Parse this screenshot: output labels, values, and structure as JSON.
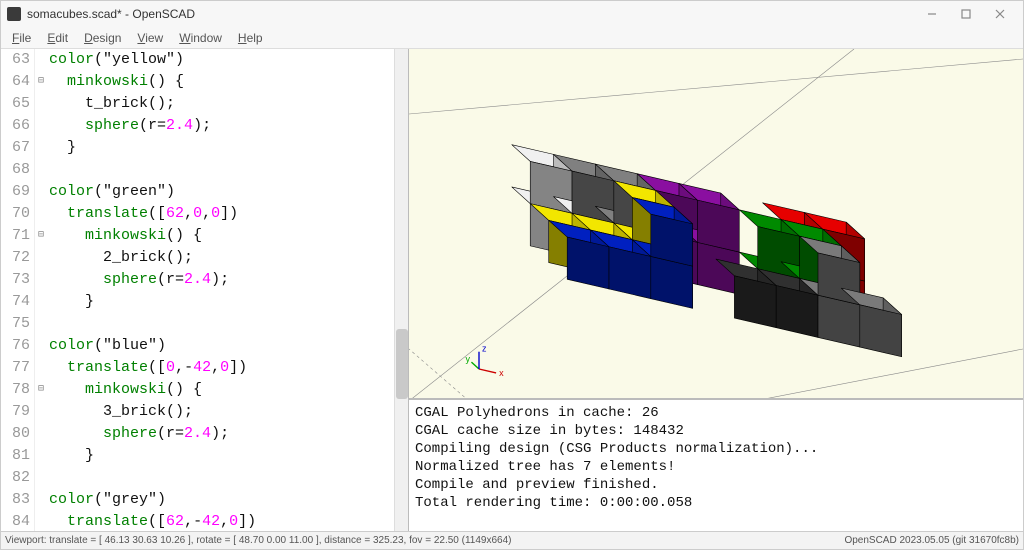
{
  "window": {
    "title": "somacubes.scad* - OpenSCAD"
  },
  "menu": {
    "file": "File",
    "edit": "Edit",
    "design": "Design",
    "view": "View",
    "window": "Window",
    "help": "Help"
  },
  "code": {
    "lines": [
      {
        "n": 63,
        "fold": "",
        "indent": 0,
        "tokens": [
          [
            "kw",
            "color"
          ],
          [
            "p",
            "("
          ],
          [
            "p",
            "\"yellow\""
          ],
          [
            "p",
            ")"
          ]
        ]
      },
      {
        "n": 64,
        "fold": "⊟",
        "indent": 1,
        "tokens": [
          [
            "kw",
            "minkowski"
          ],
          [
            "p",
            "() {"
          ]
        ]
      },
      {
        "n": 65,
        "fold": "",
        "indent": 2,
        "tokens": [
          [
            "p",
            "t_brick();"
          ]
        ]
      },
      {
        "n": 66,
        "fold": "",
        "indent": 2,
        "tokens": [
          [
            "kw",
            "sphere"
          ],
          [
            "p",
            "(r="
          ],
          [
            "num",
            "2.4"
          ],
          [
            "p",
            ");"
          ]
        ]
      },
      {
        "n": 67,
        "fold": "",
        "indent": 1,
        "tokens": [
          [
            "p",
            "}"
          ]
        ]
      },
      {
        "n": 68,
        "fold": "",
        "indent": 0,
        "tokens": []
      },
      {
        "n": 69,
        "fold": "",
        "indent": 0,
        "tokens": [
          [
            "kw",
            "color"
          ],
          [
            "p",
            "("
          ],
          [
            "p",
            "\"green\""
          ],
          [
            "p",
            ")"
          ]
        ]
      },
      {
        "n": 70,
        "fold": "",
        "indent": 1,
        "tokens": [
          [
            "kw",
            "translate"
          ],
          [
            "p",
            "(["
          ],
          [
            "num",
            "62"
          ],
          [
            "p",
            ","
          ],
          [
            "num",
            "0"
          ],
          [
            "p",
            ","
          ],
          [
            "num",
            "0"
          ],
          [
            "p",
            "])"
          ]
        ]
      },
      {
        "n": 71,
        "fold": "⊟",
        "indent": 2,
        "tokens": [
          [
            "kw",
            "minkowski"
          ],
          [
            "p",
            "() {"
          ]
        ]
      },
      {
        "n": 72,
        "fold": "",
        "indent": 3,
        "tokens": [
          [
            "p",
            "2_brick();"
          ]
        ]
      },
      {
        "n": 73,
        "fold": "",
        "indent": 3,
        "tokens": [
          [
            "kw",
            "sphere"
          ],
          [
            "p",
            "(r="
          ],
          [
            "num",
            "2.4"
          ],
          [
            "p",
            ");"
          ]
        ]
      },
      {
        "n": 74,
        "fold": "",
        "indent": 2,
        "tokens": [
          [
            "p",
            "}"
          ]
        ]
      },
      {
        "n": 75,
        "fold": "",
        "indent": 0,
        "tokens": []
      },
      {
        "n": 76,
        "fold": "",
        "indent": 0,
        "tokens": [
          [
            "kw",
            "color"
          ],
          [
            "p",
            "("
          ],
          [
            "p",
            "\"blue\""
          ],
          [
            "p",
            ")"
          ]
        ]
      },
      {
        "n": 77,
        "fold": "",
        "indent": 1,
        "tokens": [
          [
            "kw",
            "translate"
          ],
          [
            "p",
            "(["
          ],
          [
            "num",
            "0"
          ],
          [
            "p",
            ",-"
          ],
          [
            "num",
            "42"
          ],
          [
            "p",
            ","
          ],
          [
            "num",
            "0"
          ],
          [
            "p",
            "])"
          ]
        ]
      },
      {
        "n": 78,
        "fold": "⊟",
        "indent": 2,
        "tokens": [
          [
            "kw",
            "minkowski"
          ],
          [
            "p",
            "() {"
          ]
        ]
      },
      {
        "n": 79,
        "fold": "",
        "indent": 3,
        "tokens": [
          [
            "p",
            "3_brick();"
          ]
        ]
      },
      {
        "n": 80,
        "fold": "",
        "indent": 3,
        "tokens": [
          [
            "kw",
            "sphere"
          ],
          [
            "p",
            "(r="
          ],
          [
            "num",
            "2.4"
          ],
          [
            "p",
            ");"
          ]
        ]
      },
      {
        "n": 81,
        "fold": "",
        "indent": 2,
        "tokens": [
          [
            "p",
            "}"
          ]
        ]
      },
      {
        "n": 82,
        "fold": "",
        "indent": 0,
        "tokens": []
      },
      {
        "n": 83,
        "fold": "",
        "indent": 0,
        "tokens": [
          [
            "kw",
            "color"
          ],
          [
            "p",
            "("
          ],
          [
            "p",
            "\"grey\""
          ],
          [
            "p",
            ")"
          ]
        ]
      },
      {
        "n": 84,
        "fold": "",
        "indent": 1,
        "tokens": [
          [
            "kw",
            "translate"
          ],
          [
            "p",
            "(["
          ],
          [
            "num",
            "62"
          ],
          [
            "p",
            ",-"
          ],
          [
            "num",
            "42"
          ],
          [
            "p",
            ","
          ],
          [
            "num",
            "0"
          ],
          [
            "p",
            "])"
          ]
        ]
      }
    ]
  },
  "viewport_axes": {
    "x": "x",
    "y": "y",
    "z": "z"
  },
  "pieces": [
    {
      "color": "#f0f0f0",
      "dark": "#c8c8c8",
      "cells": [
        [
          -1,
          2,
          0
        ],
        [
          -1,
          2,
          1
        ],
        [
          0,
          2,
          0
        ]
      ]
    },
    {
      "color": "#808080",
      "dark": "#5a5a5a",
      "cells": [
        [
          0,
          2,
          1
        ],
        [
          1,
          2,
          0
        ],
        [
          1,
          2,
          1
        ]
      ]
    },
    {
      "color": "#8a0fa0",
      "dark": "#600b70",
      "cells": [
        [
          2,
          2,
          0
        ],
        [
          2,
          2,
          1
        ],
        [
          3,
          2,
          0
        ],
        [
          3,
          2,
          1
        ]
      ]
    },
    {
      "color": "#e60000",
      "dark": "#a80000",
      "cells": [
        [
          5,
          2,
          1
        ],
        [
          6,
          2,
          0
        ],
        [
          6,
          2,
          1
        ]
      ]
    },
    {
      "color": "#f2e600",
      "dark": "#b8b000",
      "cells": [
        [
          -1,
          1,
          0
        ],
        [
          0,
          1,
          0
        ],
        [
          1,
          1,
          0
        ],
        [
          1,
          1,
          1
        ]
      ]
    },
    {
      "color": "#008a00",
      "dark": "#006000",
      "cells": [
        [
          4,
          1,
          0
        ],
        [
          4,
          1,
          1
        ],
        [
          5,
          1,
          0
        ],
        [
          5,
          1,
          1
        ]
      ]
    },
    {
      "color": "#0020c0",
      "dark": "#001680",
      "cells": [
        [
          -1,
          0,
          0
        ],
        [
          0,
          0,
          0
        ],
        [
          1,
          0,
          0
        ],
        [
          1,
          0,
          1
        ]
      ]
    },
    {
      "color": "#303030",
      "dark": "#181818",
      "cells": [
        [
          3,
          0,
          0
        ],
        [
          4,
          0,
          0
        ]
      ]
    },
    {
      "color": "#7a7a7a",
      "dark": "#585858",
      "cells": [
        [
          5,
          0,
          0
        ],
        [
          6,
          0,
          0
        ],
        [
          5,
          0,
          1
        ]
      ]
    }
  ],
  "console": {
    "lines": [
      "CGAL Polyhedrons in cache: 26",
      "CGAL cache size in bytes: 148432",
      "Compiling design (CSG Products normalization)...",
      "Normalized tree has 7 elements!",
      "Compile and preview finished.",
      "Total rendering time: 0:00:00.058"
    ]
  },
  "status": {
    "left": "Viewport: translate = [ 46.13 30.63 10.26 ], rotate = [ 48.70 0.00 11.00 ], distance = 325.23, fov = 22.50 (1149x664)",
    "right": "OpenSCAD 2023.05.05 (git 31670fc8b)"
  }
}
